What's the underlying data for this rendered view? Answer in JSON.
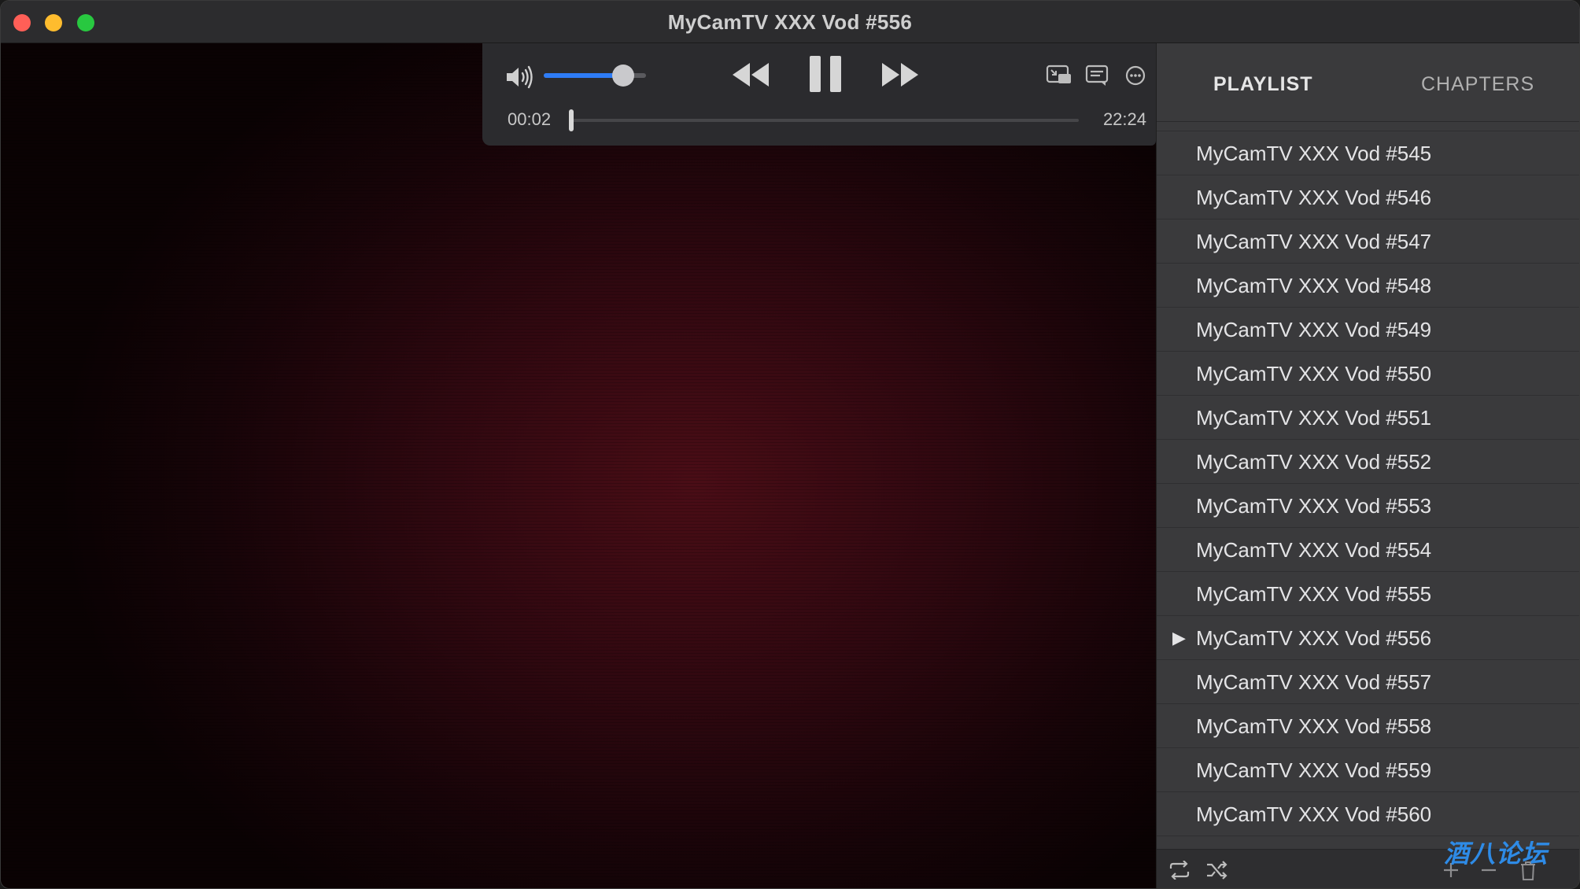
{
  "window": {
    "title": "MyCamTV XXX Vod #556"
  },
  "colors": {
    "accent": "#2e7cf6",
    "close": "#ff5f57",
    "minimize": "#febc2e",
    "maximize": "#28c840"
  },
  "controls": {
    "volume_level": 0.78,
    "current_time": "00:02",
    "duration": "22:24",
    "progress_fraction": 0.002,
    "icons": [
      "speaker-icon",
      "rewind-icon",
      "pause-icon",
      "fast-forward-icon",
      "picture-in-picture-icon",
      "subtitles-icon",
      "more-icon"
    ]
  },
  "sidebar": {
    "tabs": [
      {
        "label": "PLAYLIST",
        "active": true
      },
      {
        "label": "CHAPTERS",
        "active": false
      }
    ],
    "items": [
      {
        "label": "MyCamTV XXX Vod #545",
        "playing": false
      },
      {
        "label": "MyCamTV XXX Vod #546",
        "playing": false
      },
      {
        "label": "MyCamTV XXX Vod #547",
        "playing": false
      },
      {
        "label": "MyCamTV XXX Vod #548",
        "playing": false
      },
      {
        "label": "MyCamTV XXX Vod #549",
        "playing": false
      },
      {
        "label": "MyCamTV XXX Vod #550",
        "playing": false
      },
      {
        "label": "MyCamTV XXX Vod #551",
        "playing": false
      },
      {
        "label": "MyCamTV XXX Vod #552",
        "playing": false
      },
      {
        "label": "MyCamTV XXX Vod #553",
        "playing": false
      },
      {
        "label": "MyCamTV XXX Vod #554",
        "playing": false
      },
      {
        "label": "MyCamTV XXX Vod #555",
        "playing": false
      },
      {
        "label": "MyCamTV XXX Vod #556",
        "playing": true
      },
      {
        "label": "MyCamTV XXX Vod #557",
        "playing": false
      },
      {
        "label": "MyCamTV XXX Vod #558",
        "playing": false
      },
      {
        "label": "MyCamTV XXX Vod #559",
        "playing": false
      },
      {
        "label": "MyCamTV XXX Vod #560",
        "playing": false
      }
    ],
    "playing_marker": "▶",
    "bottom_icons": [
      "repeat-icon",
      "shuffle-icon",
      "add-icon",
      "remove-icon",
      "trash-icon"
    ]
  },
  "watermark": "酒八论坛"
}
